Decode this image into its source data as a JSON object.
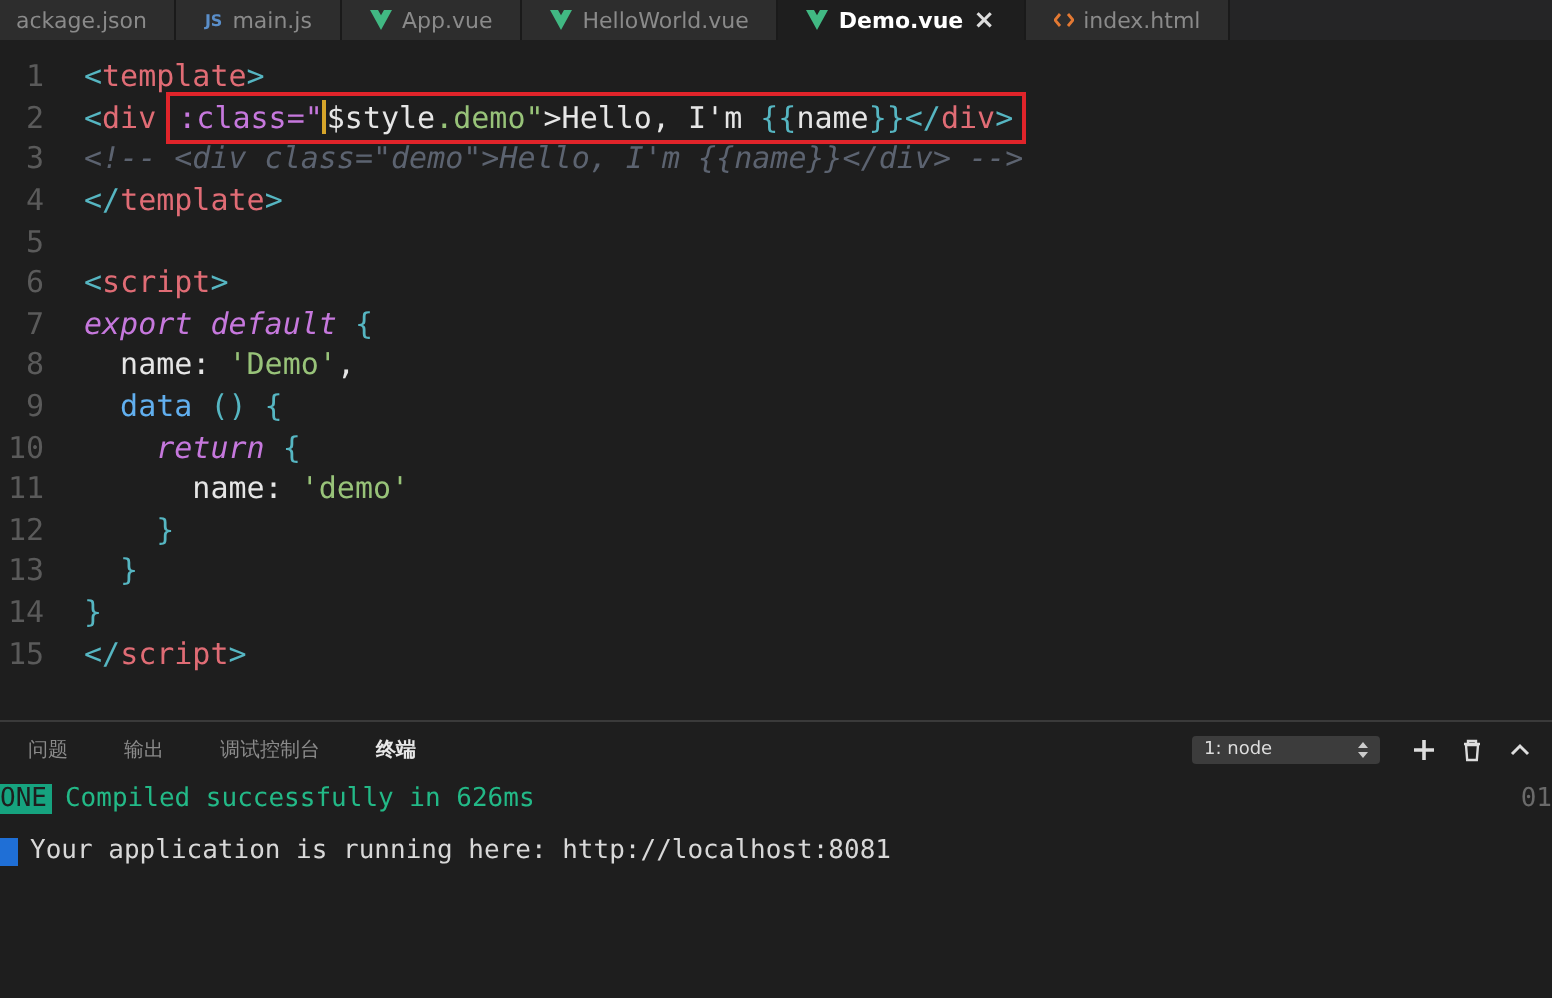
{
  "tabs": [
    {
      "label": "ackage.json",
      "kind": "plain",
      "selected": false
    },
    {
      "label": "main.js",
      "kind": "js",
      "icon_text": "JS",
      "selected": false
    },
    {
      "label": "App.vue",
      "kind": "vue",
      "selected": false
    },
    {
      "label": "HelloWorld.vue",
      "kind": "vue",
      "selected": false
    },
    {
      "label": "Demo.vue",
      "kind": "vue",
      "selected": true,
      "close": "×"
    },
    {
      "label": "index.html",
      "kind": "html",
      "selected": false
    }
  ],
  "editor": {
    "lines": [
      {
        "number": "1",
        "tokens": [
          {
            "text": "<",
            "kind": "punct"
          },
          {
            "text": "template",
            "kind": "tag"
          },
          {
            "text": ">",
            "kind": "punct"
          }
        ]
      },
      {
        "number": "2",
        "tokens": [
          {
            "text": "<",
            "kind": "punct"
          },
          {
            "text": "div ",
            "kind": "tag"
          }
        ],
        "cursor": true,
        "boxed": [
          {
            "text": ":class=\"",
            "kind": "attr"
          }
        ],
        "boxed_rest": [
          {
            "text": "$style",
            "kind": "plain"
          },
          {
            "text": ".demo\"",
            "kind": "string"
          },
          {
            "text": ">Hello, I'm ",
            "kind": "plain"
          },
          {
            "text": "{{",
            "kind": "punct"
          },
          {
            "text": "name",
            "kind": "plain"
          },
          {
            "text": "}}",
            "kind": "punct"
          },
          {
            "text": "</",
            "kind": "punct"
          },
          {
            "text": "div",
            "kind": "tag"
          },
          {
            "text": ">",
            "kind": "punct"
          }
        ]
      },
      {
        "number": "3",
        "tokens": [
          {
            "text": "<!-- <div class=\"demo\">Hello, I'm {{name}}</div> -->",
            "kind": "comment"
          }
        ]
      },
      {
        "number": "4",
        "tokens": [
          {
            "text": "</",
            "kind": "punct"
          },
          {
            "text": "template",
            "kind": "tag"
          },
          {
            "text": ">",
            "kind": "punct"
          }
        ]
      },
      {
        "number": "5"
      },
      {
        "number": "6",
        "tokens": [
          {
            "text": "<",
            "kind": "punct"
          },
          {
            "text": "script",
            "kind": "tag"
          },
          {
            "text": ">",
            "kind": "punct"
          }
        ]
      },
      {
        "number": "7",
        "tokens": [
          {
            "text": "export default",
            "kind": "keyword"
          },
          {
            "text": " {",
            "kind": "punct"
          }
        ]
      },
      {
        "number": "8",
        "tokens": [
          {
            "text": "  name: ",
            "kind": "plain"
          },
          {
            "text": "'Demo'",
            "kind": "string"
          },
          {
            "text": ",",
            "kind": "plain"
          }
        ]
      },
      {
        "number": "9",
        "tokens": [
          {
            "text": "  data ",
            "kind": "func"
          },
          {
            "text": "() {",
            "kind": "punct"
          }
        ]
      },
      {
        "number": "10",
        "tokens": [
          {
            "text": "    return",
            "kind": "keyword"
          },
          {
            "text": " {",
            "kind": "punct"
          }
        ]
      },
      {
        "number": "11",
        "tokens": [
          {
            "text": "      name: ",
            "kind": "plain"
          },
          {
            "text": "'demo'",
            "kind": "string"
          }
        ]
      },
      {
        "number": "12",
        "tokens": [
          {
            "text": "    }",
            "kind": "punct"
          }
        ]
      },
      {
        "number": "13",
        "tokens": [
          {
            "text": "  }",
            "kind": "punct"
          }
        ]
      },
      {
        "number": "14",
        "tokens": [
          {
            "text": "}",
            "kind": "punct"
          }
        ]
      },
      {
        "number": "15",
        "tokens": [
          {
            "text": "</",
            "kind": "punct"
          },
          {
            "text": "script",
            "kind": "tag"
          },
          {
            "text": ">",
            "kind": "punct"
          }
        ]
      }
    ]
  },
  "panel": {
    "tabs": [
      {
        "label": "问题",
        "selected": false
      },
      {
        "label": "输出",
        "selected": false
      },
      {
        "label": "调试控制台",
        "selected": false
      },
      {
        "label": "终端",
        "selected": true
      }
    ],
    "terminal_select": "1: node",
    "lines": [
      {
        "kind": "badge",
        "badge": "ONE",
        "text": "Compiled successfully in 626ms",
        "time": "01"
      },
      {
        "kind": "info",
        "text": "Your application is running here: http://localhost:8081"
      }
    ]
  }
}
